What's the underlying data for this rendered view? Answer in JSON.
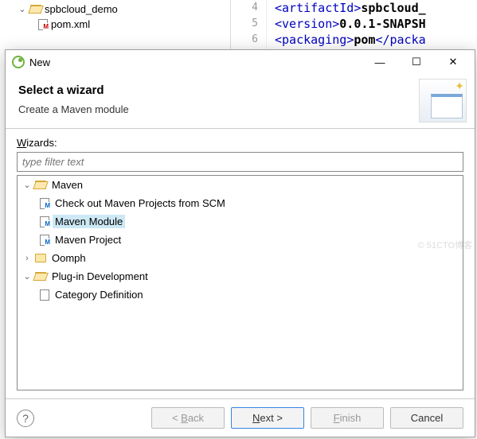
{
  "projectTree": {
    "root": "spbcloud_demo",
    "child": "pom.xml"
  },
  "editor": {
    "lines": [
      {
        "num": "4",
        "tag": "artifactId",
        "value": "spbcloud_"
      },
      {
        "num": "5",
        "tag": "version",
        "value": "0.0.1-SNAPSH"
      },
      {
        "num": "6",
        "tag": "packaging",
        "value": "pom"
      }
    ]
  },
  "dialog": {
    "title": "New",
    "heading": "Select a wizard",
    "subheading": "Create a Maven module",
    "wizardsLabel": "Wizards:",
    "filterPlaceholder": "type filter text",
    "tree": [
      {
        "label": "Maven",
        "type": "folder",
        "level": 1,
        "expanded": true
      },
      {
        "label": "Check out Maven Projects from SCM",
        "type": "maven-checkout",
        "level": 2
      },
      {
        "label": "Maven Module",
        "type": "maven-module",
        "level": 2,
        "selected": true
      },
      {
        "label": "Maven Project",
        "type": "maven-project",
        "level": 2
      },
      {
        "label": "Oomph",
        "type": "folder",
        "level": 1,
        "expanded": false
      },
      {
        "label": "Plug-in Development",
        "type": "folder",
        "level": 1,
        "expanded": true
      },
      {
        "label": "Category Definition",
        "type": "file",
        "level": 2
      }
    ],
    "buttons": {
      "back": "< Back",
      "next": "Next >",
      "finish": "Finish",
      "cancel": "Cancel"
    }
  },
  "watermark": "© 51CTO博客"
}
